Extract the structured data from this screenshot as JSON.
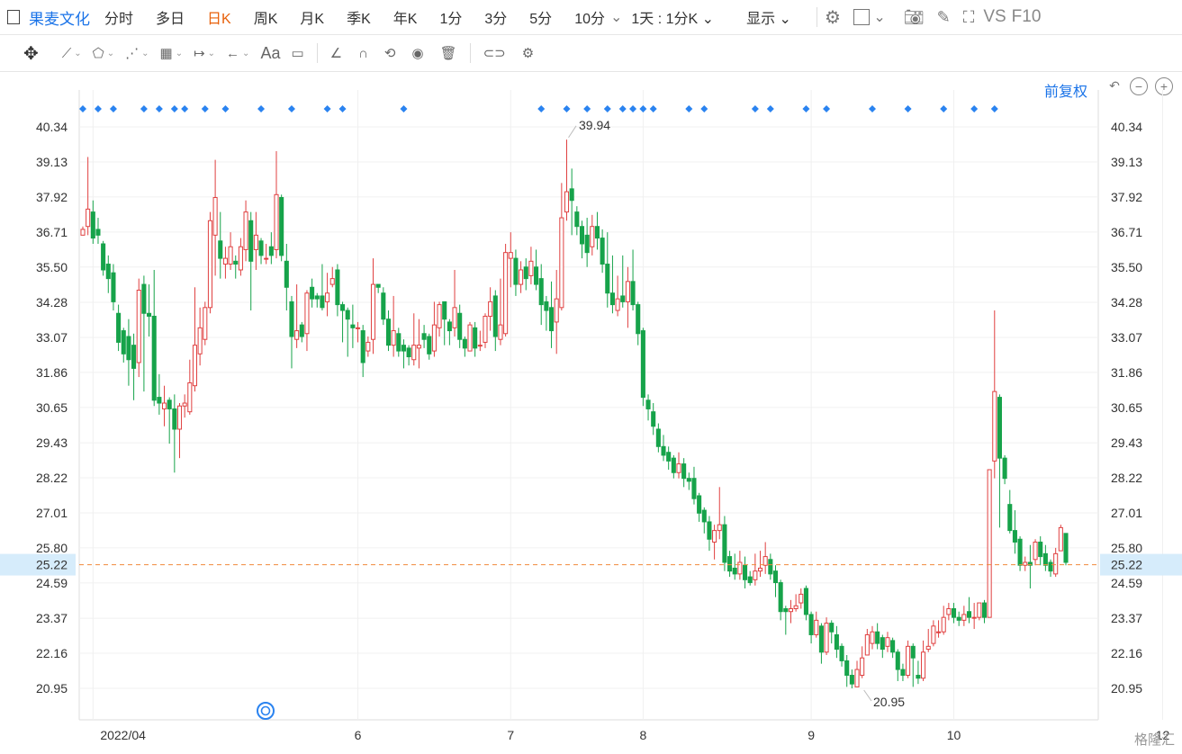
{
  "toolbar": {
    "stock_name": "果麦文化",
    "period_tabs": [
      "分时",
      "多日",
      "日K",
      "周K",
      "月K",
      "季K",
      "年K",
      "1分",
      "3分",
      "5分",
      "10分"
    ],
    "active_tab": "日K",
    "interval_label": "1天 : 1分K",
    "display_label": "显示",
    "vs_label": "VS",
    "f10_label": "F10"
  },
  "drawtools": {
    "text_tool": "Aa"
  },
  "adjust_label": "前复权",
  "chart_data": {
    "type": "candlestick",
    "y_ticks": [
      "40.34",
      "39.13",
      "37.92",
      "36.71",
      "35.50",
      "34.28",
      "33.07",
      "31.86",
      "30.65",
      "29.43",
      "28.22",
      "27.01",
      "25.80",
      "24.59",
      "23.37",
      "22.16",
      "20.95"
    ],
    "ylim": [
      20.34,
      40.94
    ],
    "x_ticks": [
      "2022/04",
      "6",
      "7",
      "8",
      "9",
      "10",
      "12"
    ],
    "current_price": "25.22",
    "high_label": "39.94",
    "low_label": "20.95",
    "candles": [
      [
        36.6,
        36.8,
        36.9,
        36.6
      ],
      [
        36.9,
        37.5,
        39.3,
        36.6
      ],
      [
        37.4,
        36.5,
        37.8,
        36.3
      ],
      [
        36.8,
        36.6,
        37.2,
        36.3
      ],
      [
        36.3,
        35.4,
        36.4,
        35.2
      ],
      [
        35.6,
        35.1,
        35.9,
        34.6
      ],
      [
        35.3,
        34.3,
        35.6,
        34.0
      ],
      [
        33.9,
        32.9,
        34.2,
        32.6
      ],
      [
        33.3,
        32.5,
        33.4,
        32.2
      ],
      [
        33.1,
        32.3,
        33.7,
        31.4
      ],
      [
        32.8,
        32.0,
        33.2,
        30.9
      ],
      [
        32.2,
        34.7,
        35.1,
        31.7
      ],
      [
        34.9,
        33.9,
        35.2,
        31.2
      ],
      [
        33.9,
        33.8,
        34.9,
        33.1
      ],
      [
        33.8,
        30.9,
        35.4,
        30.7
      ],
      [
        31.0,
        30.8,
        31.8,
        30.4
      ],
      [
        30.6,
        30.8,
        31.4,
        30.0
      ],
      [
        30.9,
        30.6,
        31.0,
        29.4
      ],
      [
        30.6,
        29.9,
        31.1,
        28.4
      ],
      [
        29.9,
        30.7,
        30.8,
        28.9
      ],
      [
        30.7,
        30.8,
        31.1,
        30.3
      ],
      [
        30.5,
        31.5,
        32.3,
        30.4
      ],
      [
        31.4,
        32.8,
        34.8,
        31.2
      ],
      [
        32.5,
        33.4,
        34.1,
        32.1
      ],
      [
        33.0,
        34.1,
        34.3,
        32.8
      ],
      [
        34.1,
        37.1,
        37.4,
        33.9
      ],
      [
        36.6,
        37.9,
        39.2,
        35.2
      ],
      [
        36.4,
        35.8,
        37.4,
        35.1
      ],
      [
        35.6,
        35.8,
        36.2,
        35.1
      ],
      [
        35.6,
        36.2,
        36.7,
        35.4
      ],
      [
        35.7,
        35.6,
        35.9,
        35.1
      ],
      [
        35.4,
        36.2,
        36.5,
        35.2
      ],
      [
        36.1,
        37.4,
        37.8,
        35.7
      ],
      [
        37.1,
        35.7,
        37.4,
        34.0
      ],
      [
        36.1,
        36.6,
        37.4,
        35.4
      ],
      [
        36.4,
        35.9,
        36.5,
        35.6
      ],
      [
        35.8,
        35.8,
        36.3,
        35.6
      ],
      [
        36.2,
        35.9,
        36.7,
        35.6
      ],
      [
        36.1,
        38.0,
        39.5,
        35.8
      ],
      [
        37.9,
        35.9,
        38.0,
        35.7
      ],
      [
        35.7,
        34.8,
        36.3,
        34.0
      ],
      [
        34.3,
        33.1,
        34.5,
        32.0
      ],
      [
        33.0,
        33.3,
        34.9,
        32.7
      ],
      [
        33.5,
        33.1,
        33.6,
        32.9
      ],
      [
        33.2,
        34.6,
        34.7,
        32.6
      ],
      [
        34.8,
        34.4,
        35.1,
        34.1
      ],
      [
        34.5,
        34.4,
        34.6,
        34.1
      ],
      [
        34.5,
        34.1,
        35.6,
        34.0
      ],
      [
        34.3,
        34.6,
        35.3,
        33.8
      ],
      [
        34.9,
        35.1,
        35.5,
        34.8
      ],
      [
        35.4,
        34.2,
        35.6,
        33.8
      ],
      [
        34.2,
        34.0,
        34.3,
        32.9
      ],
      [
        34.0,
        33.7,
        34.1,
        32.4
      ],
      [
        33.5,
        33.4,
        34.2,
        32.7
      ],
      [
        33.4,
        33.4,
        33.6,
        32.9
      ],
      [
        33.3,
        32.2,
        33.5,
        31.7
      ],
      [
        32.6,
        32.9,
        33.1,
        32.4
      ],
      [
        33.0,
        34.9,
        35.8,
        32.5
      ],
      [
        34.9,
        34.8,
        34.9,
        34.6
      ],
      [
        34.6,
        33.7,
        34.8,
        33.5
      ],
      [
        33.7,
        32.8,
        34.0,
        32.6
      ],
      [
        32.8,
        33.3,
        34.5,
        32.4
      ],
      [
        33.2,
        32.6,
        33.4,
        32.4
      ],
      [
        32.8,
        32.6,
        33.0,
        32.0
      ],
      [
        32.7,
        32.4,
        32.8,
        32.1
      ],
      [
        32.3,
        32.8,
        33.9,
        32.1
      ],
      [
        32.7,
        32.8,
        33.7,
        32.0
      ],
      [
        33.2,
        33.0,
        33.5,
        32.7
      ],
      [
        33.1,
        32.5,
        33.2,
        32.3
      ],
      [
        32.6,
        33.5,
        34.3,
        32.4
      ],
      [
        33.4,
        34.2,
        34.3,
        33.1
      ],
      [
        34.3,
        33.7,
        34.3,
        32.8
      ],
      [
        33.6,
        33.3,
        33.7,
        32.8
      ],
      [
        33.4,
        34.1,
        35.4,
        33.1
      ],
      [
        33.9,
        33.0,
        34.2,
        32.7
      ],
      [
        33.0,
        32.7,
        33.1,
        32.4
      ],
      [
        32.6,
        33.5,
        33.6,
        32.6
      ],
      [
        33.4,
        32.7,
        33.6,
        32.4
      ],
      [
        32.8,
        32.8,
        33.3,
        32.6
      ],
      [
        32.9,
        33.8,
        33.9,
        32.7
      ],
      [
        33.8,
        34.3,
        34.8,
        33.3
      ],
      [
        34.5,
        33.1,
        34.7,
        32.6
      ],
      [
        33.0,
        33.5,
        35.1,
        32.8
      ],
      [
        33.2,
        36.0,
        36.3,
        33.1
      ],
      [
        35.8,
        36.0,
        36.7,
        34.8
      ],
      [
        35.8,
        34.9,
        36.1,
        34.5
      ],
      [
        34.9,
        35.4,
        35.7,
        34.6
      ],
      [
        35.5,
        35.1,
        35.8,
        34.7
      ],
      [
        35.2,
        35.7,
        36.2,
        34.9
      ],
      [
        35.5,
        34.9,
        36.1,
        34.7
      ],
      [
        35.1,
        34.2,
        35.6,
        33.5
      ],
      [
        34.3,
        34.0,
        34.5,
        33.3
      ],
      [
        34.1,
        33.3,
        35.0,
        32.7
      ],
      [
        33.6,
        34.4,
        35.4,
        32.5
      ],
      [
        34.1,
        37.2,
        38.4,
        34.0
      ],
      [
        37.4,
        38.1,
        39.9,
        37.1
      ],
      [
        38.2,
        37.8,
        38.9,
        36.6
      ],
      [
        37.4,
        36.9,
        37.6,
        36.6
      ],
      [
        36.9,
        36.3,
        37.1,
        35.8
      ],
      [
        36.6,
        36.0,
        37.2,
        35.5
      ],
      [
        36.2,
        36.9,
        37.3,
        35.9
      ],
      [
        36.9,
        36.5,
        37.4,
        36.1
      ],
      [
        36.5,
        35.6,
        36.8,
        35.3
      ],
      [
        35.6,
        34.6,
        36.7,
        34.1
      ],
      [
        34.6,
        34.2,
        35.9,
        33.9
      ],
      [
        34.0,
        34.4,
        35.2,
        33.8
      ],
      [
        34.5,
        34.3,
        35.9,
        34.1
      ],
      [
        34.3,
        35.0,
        35.5,
        33.4
      ],
      [
        35.0,
        34.2,
        36.1,
        34.0
      ],
      [
        34.2,
        33.2,
        34.3,
        32.8
      ],
      [
        33.3,
        31.0,
        33.4,
        30.7
      ],
      [
        30.9,
        30.6,
        31.1,
        30.2
      ],
      [
        30.5,
        30.0,
        30.8,
        29.7
      ],
      [
        29.9,
        29.3,
        30.1,
        29.1
      ],
      [
        29.3,
        29.0,
        29.7,
        28.8
      ],
      [
        29.1,
        28.8,
        29.3,
        28.5
      ],
      [
        28.9,
        28.4,
        29.0,
        28.2
      ],
      [
        28.4,
        28.7,
        29.1,
        28.2
      ],
      [
        28.7,
        28.2,
        28.9,
        27.9
      ],
      [
        28.2,
        28.1,
        28.4,
        27.8
      ],
      [
        28.2,
        27.5,
        28.6,
        27.3
      ],
      [
        27.6,
        27.0,
        27.7,
        26.7
      ],
      [
        27.1,
        26.7,
        27.2,
        26.3
      ],
      [
        26.7,
        26.1,
        26.9,
        25.7
      ],
      [
        26.0,
        26.4,
        26.6,
        25.4
      ],
      [
        26.4,
        26.6,
        27.9,
        26.1
      ],
      [
        26.6,
        25.3,
        26.9,
        25.0
      ],
      [
        25.5,
        25.0,
        25.7,
        24.8
      ],
      [
        25.1,
        24.9,
        25.6,
        24.7
      ],
      [
        24.9,
        25.3,
        25.7,
        24.7
      ],
      [
        25.2,
        24.7,
        25.5,
        24.4
      ],
      [
        24.8,
        24.6,
        25.0,
        24.5
      ],
      [
        24.7,
        25.0,
        25.6,
        24.5
      ],
      [
        25.0,
        25.1,
        25.7,
        24.8
      ],
      [
        25.2,
        25.5,
        26.0,
        24.9
      ],
      [
        25.4,
        24.9,
        25.6,
        24.7
      ],
      [
        25.0,
        24.6,
        25.2,
        24.1
      ],
      [
        24.6,
        23.6,
        24.7,
        23.3
      ],
      [
        23.7,
        23.6,
        23.8,
        22.8
      ],
      [
        23.6,
        23.7,
        24.0,
        23.2
      ],
      [
        23.7,
        23.8,
        24.2,
        23.6
      ],
      [
        23.9,
        24.2,
        24.4,
        23.7
      ],
      [
        24.4,
        23.5,
        24.5,
        23.3
      ],
      [
        23.5,
        22.8,
        23.6,
        22.5
      ],
      [
        22.8,
        23.3,
        23.6,
        22.7
      ],
      [
        23.1,
        22.2,
        23.2,
        21.8
      ],
      [
        22.2,
        23.2,
        23.4,
        22.1
      ],
      [
        23.2,
        22.9,
        23.3,
        22.5
      ],
      [
        22.8,
        22.3,
        23.1,
        22.0
      ],
      [
        22.4,
        21.9,
        22.5,
        21.7
      ],
      [
        21.9,
        21.4,
        22.1,
        21.0
      ],
      [
        21.4,
        21.1,
        21.6,
        20.95
      ],
      [
        21.0,
        21.6,
        21.9,
        21.0
      ],
      [
        21.4,
        22.0,
        22.4,
        21.3
      ],
      [
        22.1,
        22.8,
        23.0,
        22.1
      ],
      [
        22.5,
        22.9,
        23.1,
        22.3
      ],
      [
        22.9,
        22.5,
        23.2,
        22.3
      ],
      [
        22.7,
        22.3,
        22.8,
        22.0
      ],
      [
        22.4,
        22.7,
        22.9,
        22.2
      ],
      [
        22.6,
        22.2,
        22.7,
        22.0
      ],
      [
        22.2,
        21.6,
        22.3,
        21.2
      ],
      [
        21.6,
        21.4,
        21.8,
        21.2
      ],
      [
        21.4,
        22.4,
        22.6,
        21.3
      ],
      [
        22.4,
        22.0,
        22.5,
        21.0
      ],
      [
        21.4,
        21.3,
        21.9,
        21.1
      ],
      [
        21.3,
        22.2,
        22.6,
        21.2
      ],
      [
        22.3,
        22.4,
        23.0,
        22.2
      ],
      [
        22.5,
        23.1,
        23.3,
        22.4
      ],
      [
        22.9,
        22.9,
        23.3,
        22.7
      ],
      [
        22.9,
        23.4,
        23.8,
        22.8
      ],
      [
        23.5,
        23.7,
        23.9,
        23.3
      ],
      [
        23.7,
        23.4,
        23.9,
        23.2
      ],
      [
        23.4,
        23.3,
        23.6,
        23.1
      ],
      [
        23.3,
        23.5,
        23.8,
        23.1
      ],
      [
        23.6,
        23.4,
        24.1,
        23.2
      ],
      [
        23.4,
        23.4,
        23.9,
        23.0
      ],
      [
        23.4,
        23.9,
        23.9,
        23.3
      ],
      [
        23.9,
        23.4,
        24.0,
        23.2
      ],
      [
        23.4,
        28.5,
        28.5,
        23.4
      ],
      [
        28.8,
        31.2,
        34.0,
        28.2
      ],
      [
        31.0,
        28.9,
        31.1,
        26.5
      ],
      [
        28.9,
        28.2,
        29.0,
        28.0
      ],
      [
        27.3,
        26.4,
        27.8,
        26.3
      ],
      [
        26.4,
        26.0,
        27.1,
        25.6
      ],
      [
        26.1,
        25.2,
        26.2,
        25.0
      ],
      [
        25.2,
        25.3,
        25.5,
        25.0
      ],
      [
        25.3,
        25.2,
        25.9,
        24.4
      ],
      [
        25.4,
        26.0,
        26.1,
        25.2
      ],
      [
        26.0,
        25.5,
        26.2,
        25.2
      ],
      [
        25.6,
        25.2,
        25.9,
        25.0
      ],
      [
        25.3,
        25.0,
        25.4,
        24.8
      ],
      [
        24.9,
        25.6,
        25.8,
        24.8
      ],
      [
        25.7,
        26.5,
        26.6,
        25.7
      ],
      [
        26.3,
        25.3,
        26.3,
        25.2
      ]
    ]
  },
  "watermark_text": "格隆汇"
}
